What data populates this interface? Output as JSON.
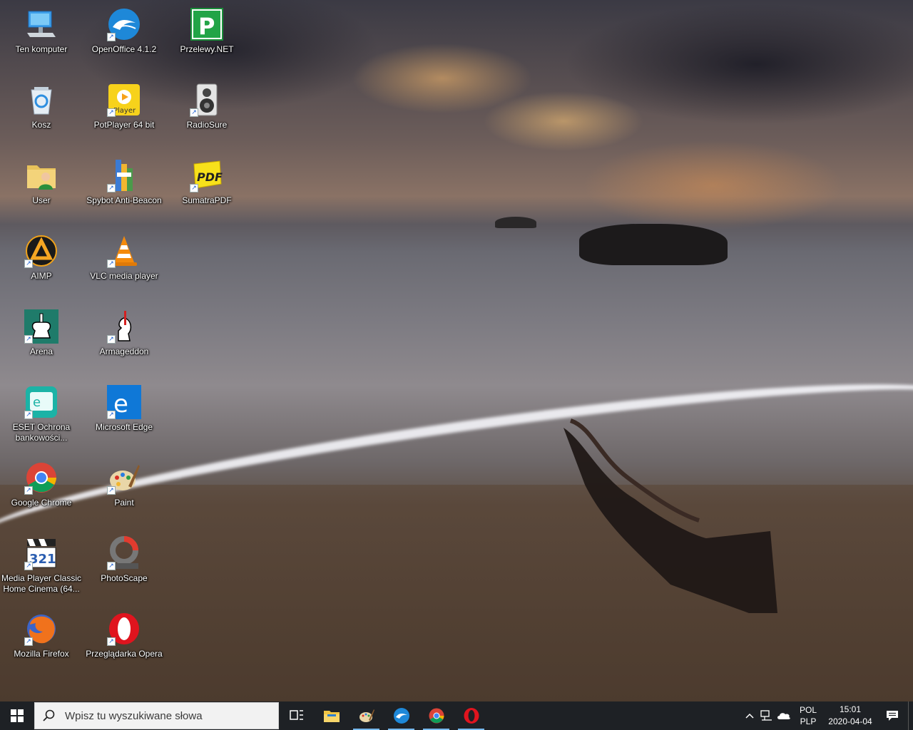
{
  "desktop": {
    "icons": [
      {
        "label": "Ten komputer",
        "icon": "computer-icon",
        "shortcut": false
      },
      {
        "label": "OpenOffice 4.1.2",
        "icon": "openoffice-icon",
        "shortcut": true
      },
      {
        "label": "Przelewy.NET",
        "icon": "przelewy-icon",
        "shortcut": false
      },
      {
        "label": "Kosz",
        "icon": "recycle-bin-icon",
        "shortcut": false
      },
      {
        "label": "PotPlayer 64 bit",
        "icon": "potplayer-icon",
        "shortcut": true,
        "glyph_text": "Player"
      },
      {
        "label": "RadioSure",
        "icon": "radiosure-icon",
        "shortcut": true
      },
      {
        "label": "User",
        "icon": "user-folder-icon",
        "shortcut": false
      },
      {
        "label": "Spybot Anti-Beacon",
        "icon": "spybot-icon",
        "shortcut": true
      },
      {
        "label": "SumatraPDF",
        "icon": "sumatrapdf-icon",
        "shortcut": true,
        "glyph_text": "PDF"
      },
      {
        "label": "AIMP",
        "icon": "aimp-icon",
        "shortcut": true
      },
      {
        "label": "VLC media player",
        "icon": "vlc-icon",
        "shortcut": true
      },
      {
        "label": "Arena",
        "icon": "arena-chess-icon",
        "shortcut": true
      },
      {
        "label": "Armageddon",
        "icon": "armageddon-icon",
        "shortcut": true
      },
      {
        "label": "ESET Ochrona bankowości...",
        "icon": "eset-icon",
        "shortcut": true
      },
      {
        "label": "Microsoft Edge",
        "icon": "edge-icon",
        "shortcut": true
      },
      {
        "label": "Google Chrome",
        "icon": "chrome-icon",
        "shortcut": true
      },
      {
        "label": "Paint",
        "icon": "paint-icon",
        "shortcut": true
      },
      {
        "label": "Media Player Classic Home Cinema (64...",
        "icon": "mpc-hc-icon",
        "shortcut": true,
        "glyph_text": "321"
      },
      {
        "label": "PhotoScape",
        "icon": "photoscape-icon",
        "shortcut": true
      },
      {
        "label": "Mozilla Firefox",
        "icon": "firefox-icon",
        "shortcut": true
      },
      {
        "label": "Przeglądarka Opera",
        "icon": "opera-icon",
        "shortcut": true
      }
    ]
  },
  "taskbar": {
    "search_placeholder": "Wpisz tu wyszukiwane słowa",
    "pinned": [
      {
        "name": "task-view",
        "icon": "task-view-icon"
      },
      {
        "name": "file-explorer",
        "icon": "folder-icon"
      },
      {
        "name": "paint",
        "icon": "paint-icon"
      },
      {
        "name": "openoffice",
        "icon": "openoffice-icon"
      },
      {
        "name": "chrome",
        "icon": "chrome-icon"
      },
      {
        "name": "opera",
        "icon": "opera-icon"
      }
    ],
    "tray": {
      "lang_top": "POL",
      "lang_bottom": "PLP",
      "time": "15:01",
      "date": "2020-04-04"
    },
    "colors": {
      "bar": "#1e2125",
      "active_underline": "#76b9ed"
    }
  }
}
